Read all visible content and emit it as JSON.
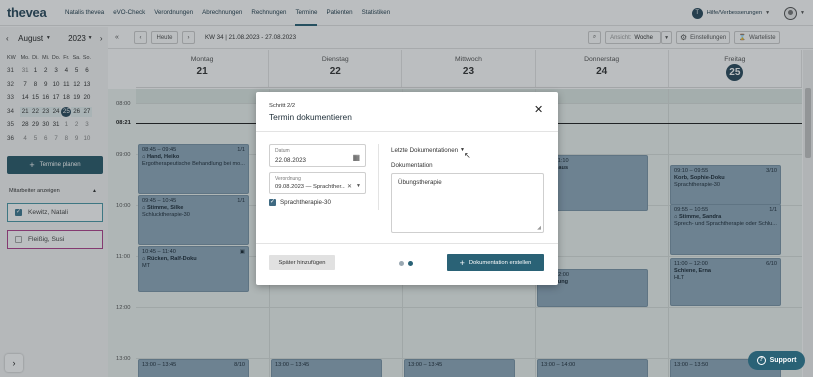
{
  "app": {
    "logo": "thevea",
    "nav": [
      {
        "label": "Natalis thevea",
        "active": false
      },
      {
        "label": "eVO-Check",
        "active": false
      },
      {
        "label": "Verordnungen",
        "active": false
      },
      {
        "label": "Abrechnungen",
        "active": false
      },
      {
        "label": "Rechnungen",
        "active": false
      },
      {
        "label": "Termine",
        "active": true
      },
      {
        "label": "Patienten",
        "active": false
      },
      {
        "label": "Statistiken",
        "active": false
      }
    ],
    "help_badge": "T",
    "help_label": "Hilfe/Verbesserungen"
  },
  "minical": {
    "month": "August",
    "year": "2023",
    "headers": [
      "KW",
      "Mo.",
      "Di.",
      "Mi.",
      "Do.",
      "Fr.",
      "Sa.",
      "So."
    ],
    "rows": [
      [
        "31",
        "31",
        "1",
        "2",
        "3",
        "4",
        "5",
        "6"
      ],
      [
        "32",
        "7",
        "8",
        "9",
        "10",
        "11",
        "12",
        "13"
      ],
      [
        "33",
        "14",
        "15",
        "16",
        "17",
        "18",
        "19",
        "20"
      ],
      [
        "34",
        "21",
        "22",
        "23",
        "24",
        "25",
        "26",
        "27"
      ],
      [
        "35",
        "28",
        "29",
        "30",
        "31",
        "1",
        "2",
        "3"
      ],
      [
        "36",
        "4",
        "5",
        "6",
        "7",
        "8",
        "9",
        "10"
      ]
    ]
  },
  "left": {
    "plan_button": "Termine planen",
    "staff_header": "Mitarbeiter anzeigen",
    "staff": [
      {
        "name": "Kewitz, Natali",
        "checked": true,
        "color": "#4c9aa8"
      },
      {
        "name": "Fleißig, Susi",
        "checked": false,
        "color": "#b0438f"
      }
    ]
  },
  "toolbar": {
    "today": "Heute",
    "week_label": "KW 34 | 21.08.2023 - 27.08.2023",
    "view_label": "Ansicht:",
    "view_value": "Woche",
    "settings": "Einstellungen",
    "waitlist": "Warteliste"
  },
  "days": [
    {
      "name": "Montag",
      "num": "21",
      "today": false
    },
    {
      "name": "Dienstag",
      "num": "22",
      "today": false
    },
    {
      "name": "Mittwoch",
      "num": "23",
      "today": false
    },
    {
      "name": "Donnerstag",
      "num": "24",
      "today": false
    },
    {
      "name": "Freitag",
      "num": "25",
      "today": true
    }
  ],
  "times": [
    "08:00",
    "09:00",
    "10:00",
    "11:00",
    "12:00",
    "13:00"
  ],
  "now_time": "08:21",
  "appointments": [
    {
      "t": "08:45 – 09:45",
      "n": "Hand, Heiko",
      "d": "Ergotherapeutische Behandlung bei mo...",
      "c": "1/1"
    },
    {
      "t": "09:45 – 10:45",
      "n": "Stimme, Silke",
      "d": "Schlucktherapie-30",
      "c": "1/1"
    },
    {
      "t": "10:45 – 11:40",
      "n": "Rücken, Ralf-Doku",
      "d": "MT",
      "c": ""
    },
    {
      "t": "13:00 – 13:45",
      "n": "",
      "d": "",
      "c": "8/10"
    },
    {
      "t": "13:00 – 13:45",
      "n": "",
      "d": "",
      "c": ""
    },
    {
      "t": "11:10",
      "n": "",
      "d": "haus",
      "c": ""
    },
    {
      "t": "12:00",
      "n": "",
      "d": "zung",
      "c": ""
    },
    {
      "t": "13:00 – 14:00",
      "n": "",
      "d": "",
      "c": ""
    },
    {
      "t": "13:00 – 13:45",
      "n": "",
      "d": "",
      "c": ""
    },
    {
      "t": "09:10 – 09:55",
      "n": "Korb, Sophie-Doku",
      "d": "Sprachtherapie-30",
      "c": "3/10"
    },
    {
      "t": "09:55 – 10:55",
      "n": "Stimme, Sandra",
      "d": "Sprech- und Sprachtherapie oder Schlu...",
      "c": "1/1"
    },
    {
      "t": "11:00 – 12:00",
      "n": "Schiene, Erna",
      "d": "HLT",
      "c": "6/10"
    },
    {
      "t": "13:00 – 13:50",
      "n": "",
      "d": "",
      "c": ""
    }
  ],
  "modal": {
    "step": "Schritt 2/2",
    "title": "Termin dokumentieren",
    "date_label": "Datum",
    "date_value": "22.08.2023",
    "rx_label": "Verordnung",
    "rx_value": "09.08.2023 — Sprachther...",
    "therapy": "Sprachtherapie-30",
    "last_docs": "Letzte Dokumentationen",
    "doc_label": "Dokumentation",
    "doc_value": "Übungstherapie",
    "later_button": "Später hinzufügen",
    "save_button": "Dokumentation erstellen"
  },
  "support": "Support",
  "colors": {
    "primary": "#2a6276",
    "appointment": "#90a9bc",
    "today_badge": "#2a4a5c"
  }
}
